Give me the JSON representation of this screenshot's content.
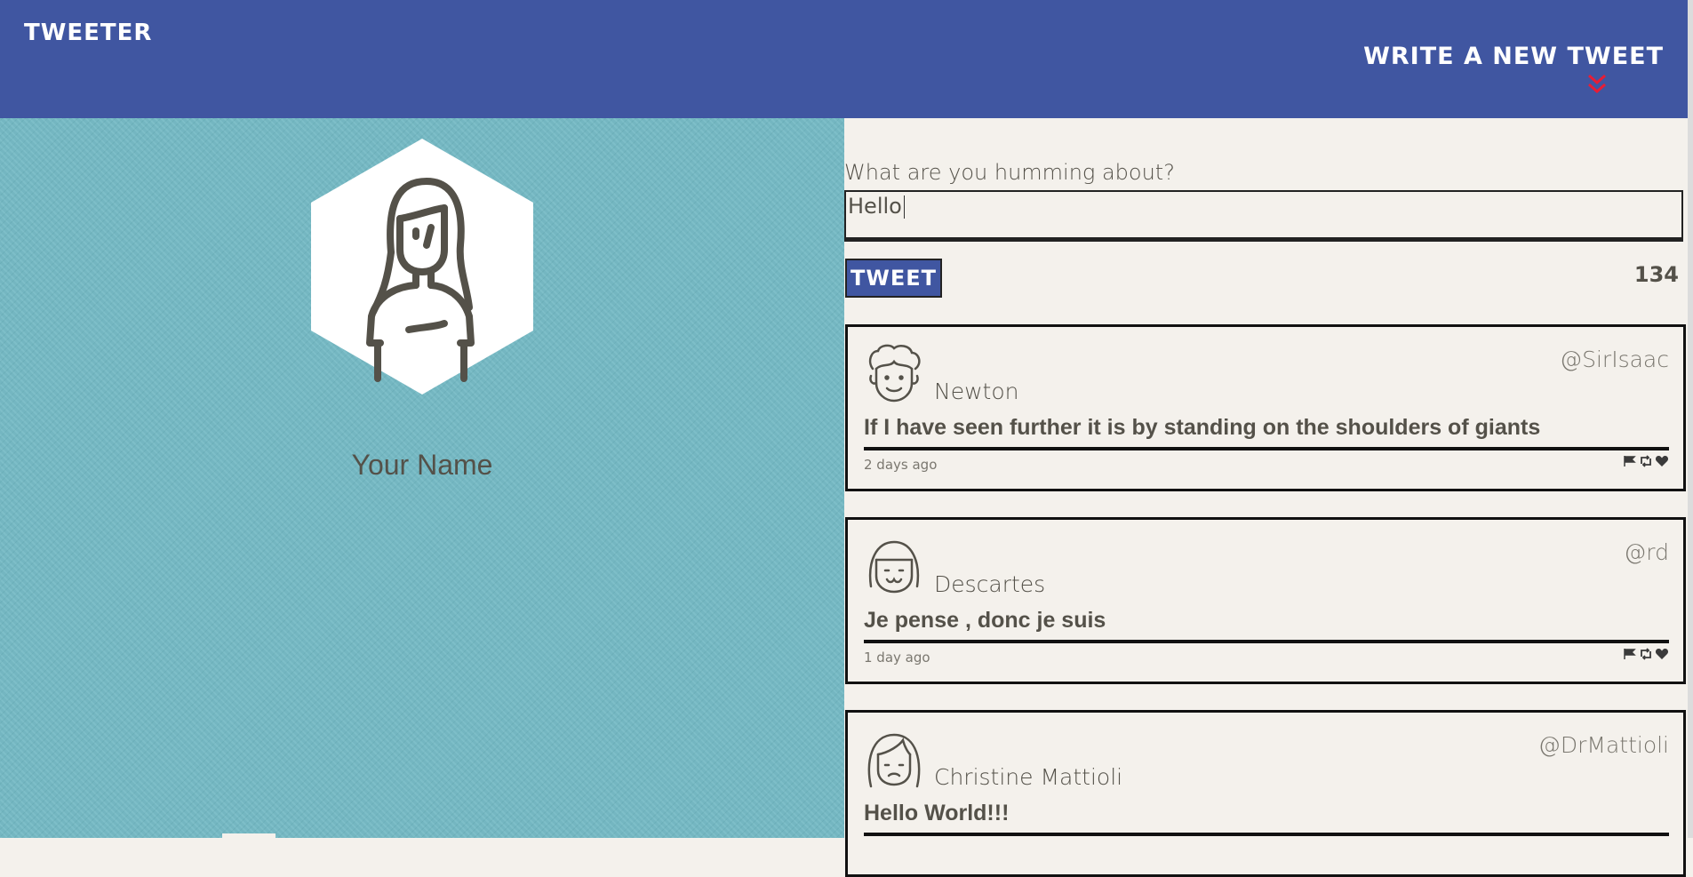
{
  "header": {
    "brand": "TWEETER",
    "compose_toggle_label": "WRITE A NEW TWEET",
    "toggle_icon": "double-chevron-down-icon",
    "colors": {
      "bar": "#4056a1",
      "accent": "#e71d36"
    }
  },
  "profile": {
    "name": "Your Name",
    "avatar_icon": "woman-avatar-icon"
  },
  "compose": {
    "label": "What are you humming about?",
    "value": "Hello",
    "button_label": "TWEET",
    "remaining": "134"
  },
  "tweets": [
    {
      "avatar_icon": "curly-man-avatar-icon",
      "name": "Newton",
      "handle": "@SirIsaac",
      "content": "If I have seen further it is by standing on the shoulders of giants",
      "time": "2 days ago"
    },
    {
      "avatar_icon": "bob-hair-avatar-icon",
      "name": "Descartes",
      "handle": "@rd",
      "content": "Je pense , donc je suis",
      "time": "1 day ago"
    },
    {
      "avatar_icon": "long-hair-avatar-icon",
      "name": "Christine Mattioli",
      "handle": "@DrMattioli",
      "content": "Hello World!!!",
      "time": ""
    }
  ],
  "tweet_actions": [
    "flag-icon",
    "retweet-icon",
    "heart-icon"
  ]
}
